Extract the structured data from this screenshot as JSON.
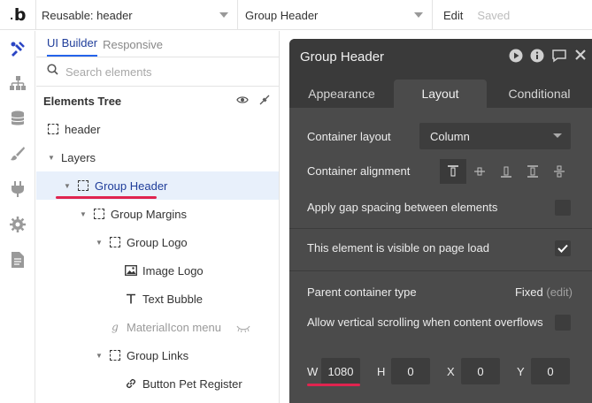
{
  "topbar": {
    "logo": "b",
    "page_select": "Reusable: header",
    "element_select": "Group Header",
    "edit_label": "Edit",
    "saved_label": "Saved"
  },
  "rail": {
    "icons": [
      "design-icon",
      "workflow-icon",
      "data-icon",
      "styles-icon",
      "plugins-icon",
      "settings-icon",
      "logs-icon"
    ]
  },
  "panel": {
    "tabs": [
      "UI Builder",
      "Responsive"
    ],
    "search_placeholder": "Search elements",
    "tree_title": "Elements Tree",
    "items": [
      {
        "label": "header",
        "indent": 0,
        "toggle": "",
        "icon": "group-icon"
      },
      {
        "label": "Layers",
        "indent": 0,
        "toggle": "▼",
        "icon": ""
      },
      {
        "label": "Group Header",
        "indent": 1,
        "toggle": "▼",
        "icon": "group-icon"
      },
      {
        "label": "Group Margins",
        "indent": 2,
        "toggle": "▼",
        "icon": "group-icon"
      },
      {
        "label": "Group Logo",
        "indent": 3,
        "toggle": "▼",
        "icon": "group-icon"
      },
      {
        "label": "Image Logo",
        "indent": 4,
        "toggle": "",
        "icon": "image-icon"
      },
      {
        "label": "Text Bubble",
        "indent": 4,
        "toggle": "",
        "icon": "text-icon"
      },
      {
        "label": "MaterialIcon menu",
        "indent": 3,
        "toggle": "",
        "icon": "materialicon-icon"
      },
      {
        "label": "Group Links",
        "indent": 3,
        "toggle": "▼",
        "icon": "group-icon"
      },
      {
        "label": "Button Pet Register",
        "indent": 4,
        "toggle": "",
        "icon": "link-icon"
      }
    ]
  },
  "editor": {
    "title": "Group Header",
    "tabs": [
      "Appearance",
      "Layout",
      "Conditional"
    ],
    "active_tab": "Layout",
    "container_layout_label": "Container layout",
    "container_layout_value": "Column",
    "container_alignment_label": "Container alignment",
    "gap_label": "Apply gap spacing between elements",
    "gap_checked": false,
    "visible_label": "This element is visible on page load",
    "visible_checked": true,
    "parent_type_label": "Parent container type",
    "parent_type_value": "Fixed",
    "parent_type_edit": "(edit)",
    "scroll_label": "Allow vertical scrolling when content overflows",
    "scroll_checked": false,
    "w_label": "W",
    "w_value": "1080",
    "h_label": "H",
    "h_value": "0",
    "x_label": "X",
    "x_value": "0",
    "y_label": "Y",
    "y_value": "0"
  },
  "colors": {
    "accent": "#2563eb",
    "highlight": "#e0244f",
    "editor_bg": "#4b4b4b",
    "editor_head": "#3a3a3a"
  }
}
